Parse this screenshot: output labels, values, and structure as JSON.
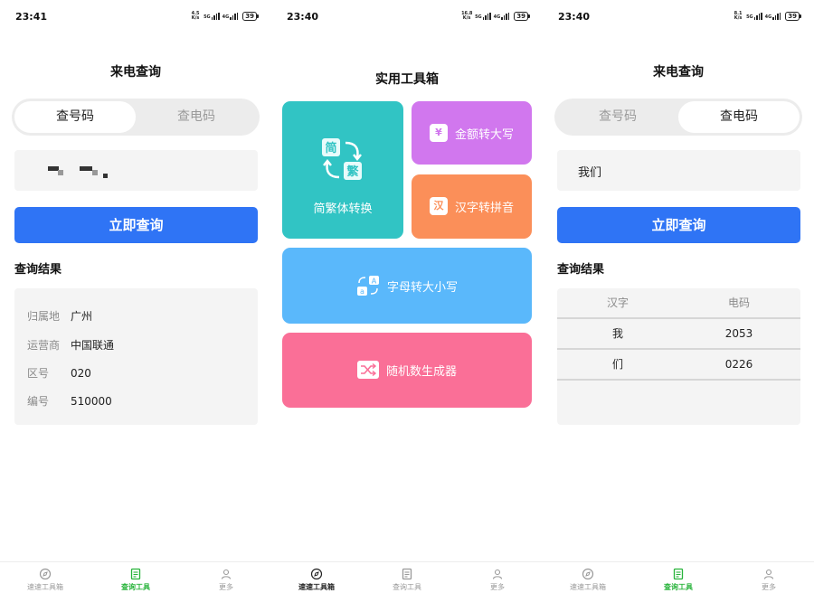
{
  "screens": [
    {
      "status": {
        "time": "23:41",
        "speed_top": "4.5",
        "speed_unit": "K/s",
        "net1": "5G",
        "net2": "4G",
        "battery": "39"
      },
      "title": "来电查询",
      "segment": {
        "option1": "查号码",
        "option2": "查电码",
        "active": 1
      },
      "input": {
        "value": ""
      },
      "button": "立即查询",
      "result_title": "查询结果",
      "result": [
        {
          "key": "归属地",
          "value": "广州"
        },
        {
          "key": "运营商",
          "value": "中国联通"
        },
        {
          "key": "区号",
          "value": "020"
        },
        {
          "key": "编号",
          "value": "510000"
        }
      ],
      "tabs": [
        {
          "label": "速速工具箱",
          "icon": "compass-icon"
        },
        {
          "label": "查询工具",
          "icon": "document-icon"
        },
        {
          "label": "更多",
          "icon": "person-icon"
        }
      ],
      "active_tab": 1
    },
    {
      "status": {
        "time": "23:40",
        "speed_top": "16.8",
        "speed_unit": "K/s",
        "net1": "5G",
        "net2": "4G",
        "battery": "39"
      },
      "title": "实用工具箱",
      "tiles": [
        {
          "label": "简繁体转换",
          "icon": "convert-icon",
          "icon_top": "简",
          "icon_bottom": "繁",
          "color": "#31c4c4"
        },
        {
          "label": "金额转大写",
          "icon": "currency-icon",
          "icon_text": "¥",
          "color": "#d177ee"
        },
        {
          "label": "汉字转拼音",
          "icon": "chinese-icon",
          "icon_text": "汉",
          "color": "#fb8f59"
        },
        {
          "label": "字母转大小写",
          "icon": "letters-icon",
          "icon_top": "A",
          "icon_bottom": "a",
          "color": "#5ab8fb"
        },
        {
          "label": "随机数生成器",
          "icon": "shuffle-icon",
          "color": "#fa6f97"
        }
      ],
      "tabs": [
        {
          "label": "速速工具箱",
          "icon": "compass-icon"
        },
        {
          "label": "查询工具",
          "icon": "document-icon"
        },
        {
          "label": "更多",
          "icon": "person-icon"
        }
      ],
      "active_tab": 0
    },
    {
      "status": {
        "time": "23:40",
        "speed_top": "8.1",
        "speed_unit": "K/s",
        "net1": "5G",
        "net2": "4G",
        "battery": "39"
      },
      "title": "来电查询",
      "segment": {
        "option1": "查号码",
        "option2": "查电码",
        "active": 2
      },
      "input": {
        "value": "我们"
      },
      "button": "立即查询",
      "result_title": "查询结果",
      "table": {
        "headers": [
          "汉字",
          "电码"
        ],
        "rows": [
          [
            "我",
            "2053"
          ],
          [
            "们",
            "0226"
          ]
        ]
      },
      "tabs": [
        {
          "label": "速速工具箱",
          "icon": "compass-icon"
        },
        {
          "label": "查询工具",
          "icon": "document-icon"
        },
        {
          "label": "更多",
          "icon": "person-icon"
        }
      ],
      "active_tab": 1
    }
  ],
  "colors": {
    "primary": "#2f74f5",
    "tab_active": "#27b33a"
  }
}
